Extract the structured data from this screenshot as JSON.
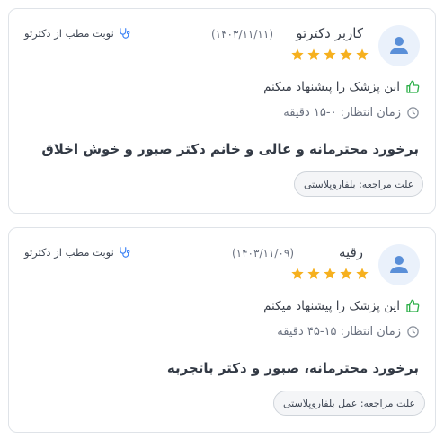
{
  "reviews": [
    {
      "user_name": "کاربر دکترتو",
      "date": "(۱۴۰۳/۱۱/۱۱)",
      "rating": 5,
      "booking_label": "نوبت مطب از دکترتو",
      "recommend_text": "این پزشک را پیشنهاد میکنم",
      "wait_time": "زمان انتظار: ۰-۱۵ دقیقه",
      "comment": "برخورد محترمانه و عالی و خانم دکتر صبور و خوش اخلاق",
      "visit_reason": "علت مراجعه: بلفاروپلاستی"
    },
    {
      "user_name": "رقیه",
      "date": "(۱۴۰۳/۱۱/۰۹)",
      "rating": 5,
      "booking_label": "نوبت مطب از دکترتو",
      "recommend_text": "این پزشک را پیشنهاد میکنم",
      "wait_time": "زمان انتظار: ۱۵-۴۵ دقیقه",
      "comment": "برخورد محترمانه، صبور و دکتر باتجربه",
      "visit_reason": "علت مراجعه: عمل بلفاروپلاستی"
    }
  ],
  "colors": {
    "star": "#f6b01e",
    "thumbs_up": "#2fb04a",
    "stethoscope": "#3b82f6",
    "avatar_bg": "#eaf1fb",
    "avatar_fg": "#5a8fd8"
  },
  "icons": [
    "user-avatar-icon",
    "star-icon",
    "stethoscope-icon",
    "thumbs-up-icon",
    "clock-icon"
  ]
}
